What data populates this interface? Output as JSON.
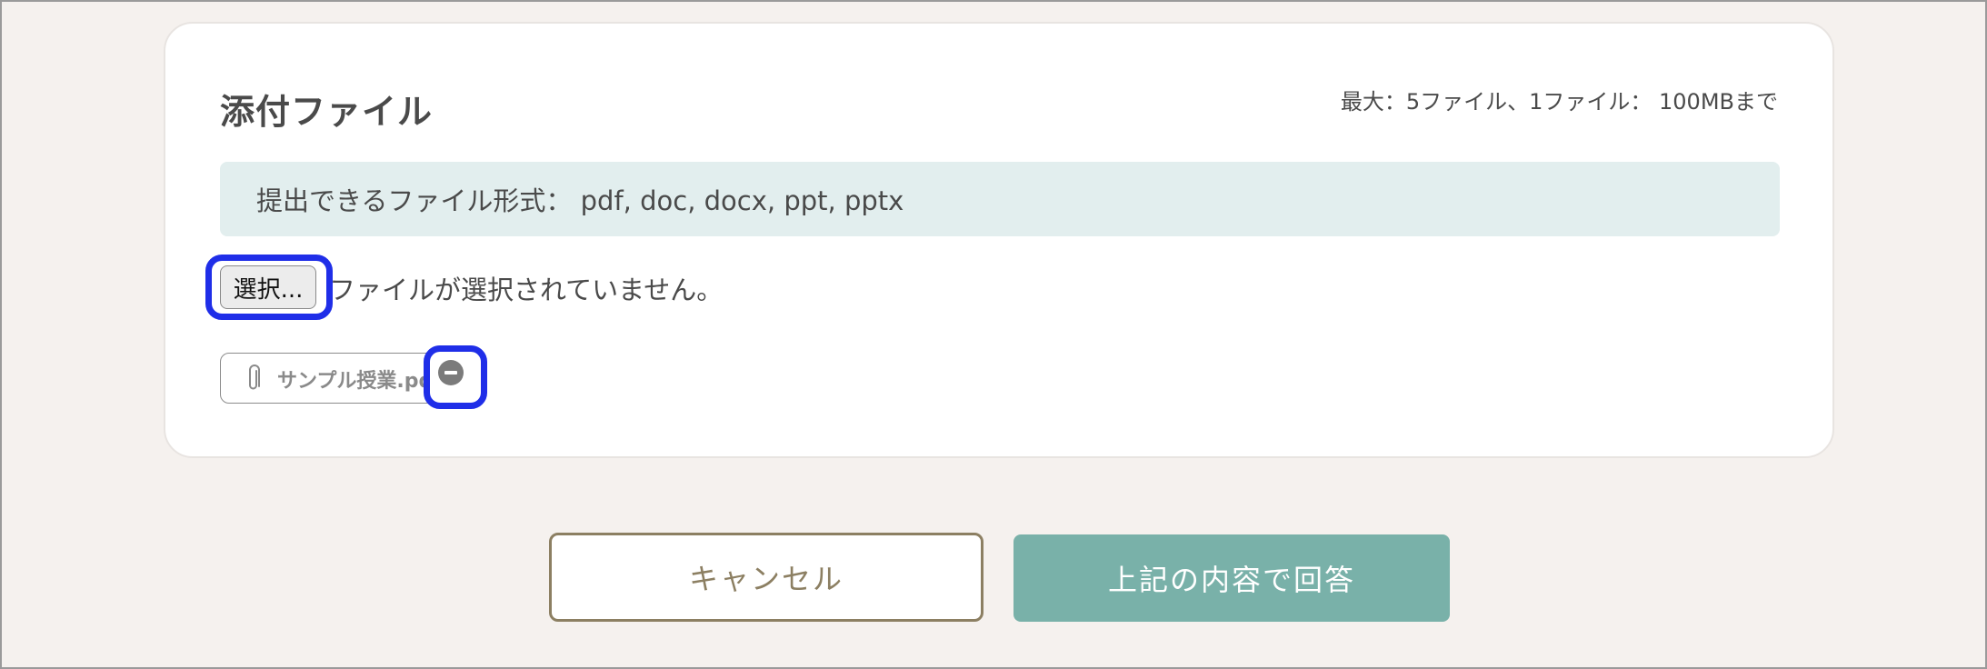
{
  "attachments": {
    "title": "添付ファイル",
    "limit_note": "最大：5ファイル、1ファイル： 100MBまで",
    "allowed_formats": "提出できるファイル形式： pdf, doc, docx, ppt, pptx",
    "select_button_label": "選択...",
    "no_file_selected": "ファイルが選択されていません。",
    "files": [
      {
        "name": "サンプル授業.pdf",
        "icon": "paperclip-icon",
        "remove_icon": "minus-circle-icon"
      }
    ]
  },
  "actions": {
    "cancel_label": "キャンセル",
    "submit_label": "上記の内容で回答"
  },
  "colors": {
    "background": "#f5f1ee",
    "banner": "#e2eeee",
    "highlight": "#1f2ee8",
    "cancel": "#8c7f62",
    "submit": "#79b1a9"
  }
}
